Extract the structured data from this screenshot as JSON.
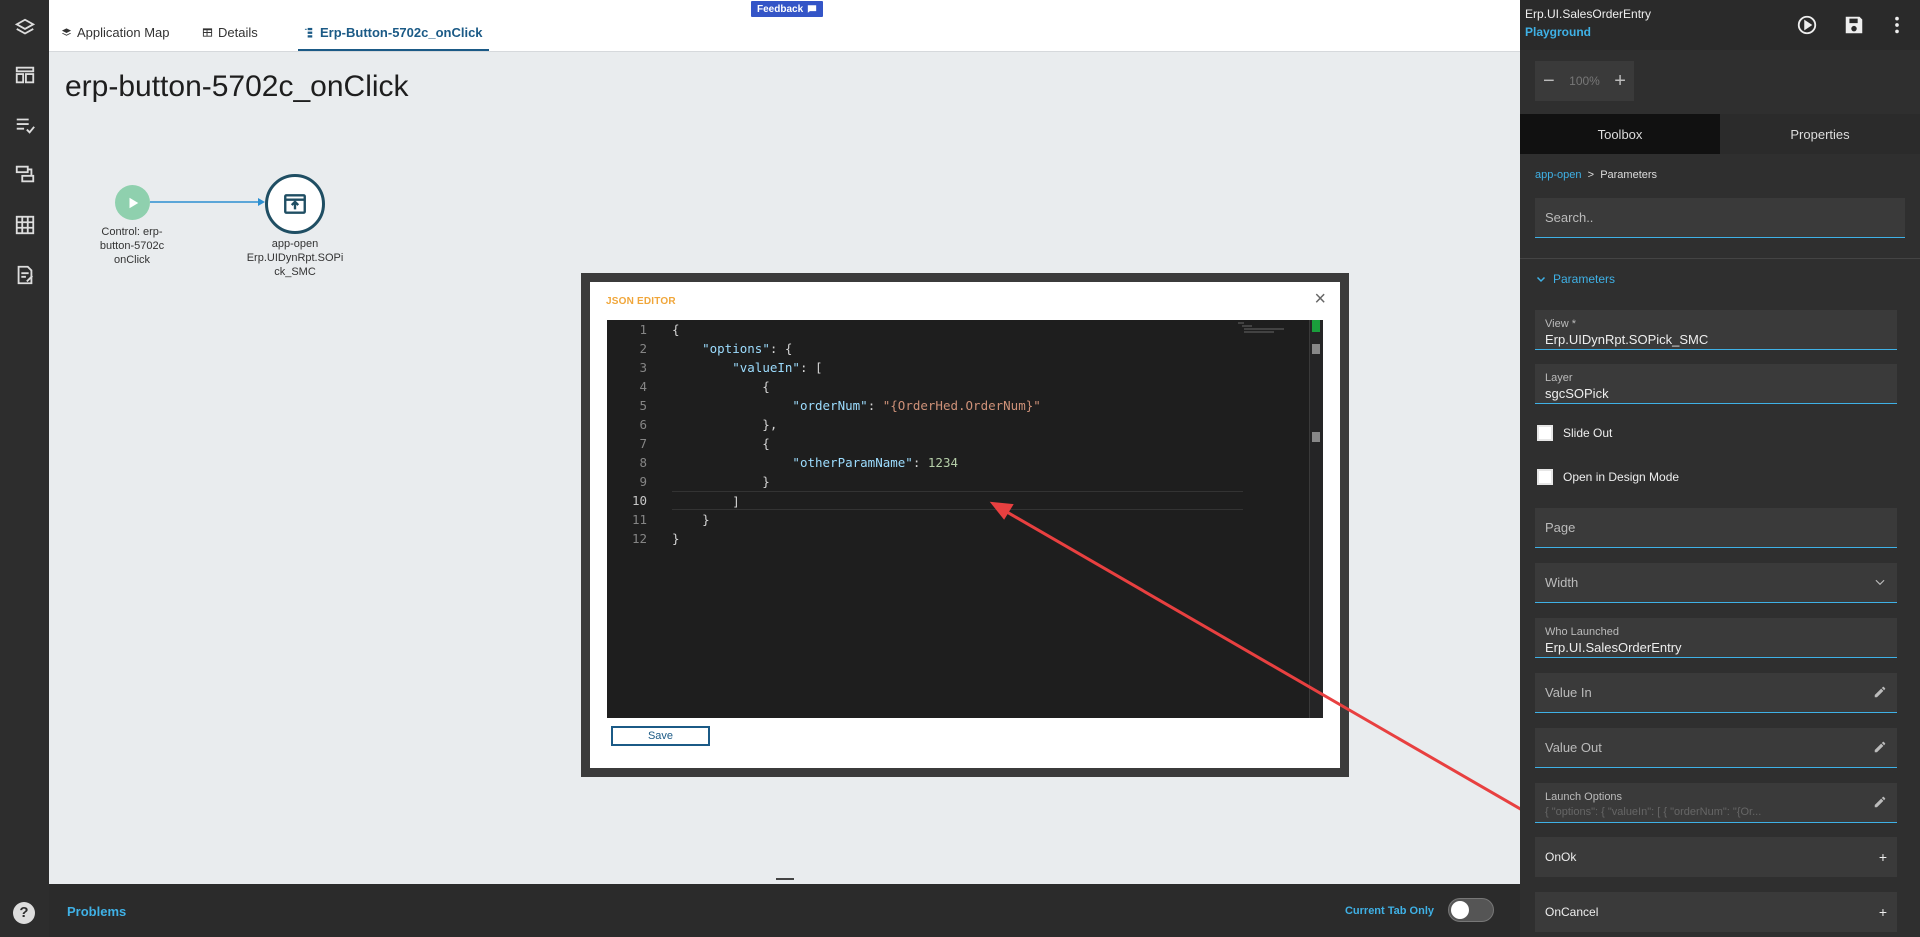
{
  "tabs": [
    {
      "label": "Application Map",
      "icon": "layers-icon"
    },
    {
      "label": "Details",
      "icon": "table-icon"
    },
    {
      "label": "Erp-Button-5702c_onClick",
      "icon": "flow-icon"
    }
  ],
  "feedback": {
    "label": "Feedback",
    "icon": "chat-icon"
  },
  "page_title": "erp-button-5702c_onClick",
  "flow": {
    "start_label": "Control: erp-\nbutton-5702c\nonClick",
    "app_label": "app-open\nErp.UIDynRpt.SOPi\nck_SMC"
  },
  "modal": {
    "title": "JSON EDITOR",
    "close": "×",
    "lines": [
      "1",
      "2",
      "3",
      "4",
      "5",
      "6",
      "7",
      "8",
      "9",
      "10",
      "11",
      "12"
    ],
    "current_line": "10",
    "save_label": "Save"
  },
  "bottom": {
    "problems": "Problems",
    "current_tab_only": "Current Tab Only"
  },
  "help": "?",
  "right_panel": {
    "app_name": "Erp.UI.SalesOrderEntry",
    "sub": "Playground",
    "zoom": {
      "minus": "−",
      "value": "100%",
      "plus": "+"
    },
    "tabs": {
      "toolbox": "Toolbox",
      "properties": "Properties"
    },
    "breadcrumb": {
      "link": "app-open",
      "sep": ">",
      "current": "Parameters"
    },
    "search_placeholder": "Search..",
    "section": "Parameters",
    "view": {
      "label": "View *",
      "value": "Erp.UIDynRpt.SOPick_SMC"
    },
    "layer": {
      "label": "Layer",
      "value": "sgcSOPick"
    },
    "slide_out": "Slide Out",
    "open_design": "Open in Design Mode",
    "page": "Page",
    "width": "Width",
    "who_launched": {
      "label": "Who Launched",
      "value": "Erp.UI.SalesOrderEntry"
    },
    "value_in": "Value In",
    "value_out": "Value Out",
    "launch_options": {
      "label": "Launch Options",
      "value": "{ \"options\": { \"valueIn\": [ { \"orderNum\": \"{Or..."
    },
    "on_ok": "OnOk",
    "on_cancel": "OnCancel",
    "plus": "+"
  },
  "colors": {
    "accent": "#3fb1e6",
    "brand_dark": "#1b5a86",
    "annotation_arrow": "#e84040"
  }
}
